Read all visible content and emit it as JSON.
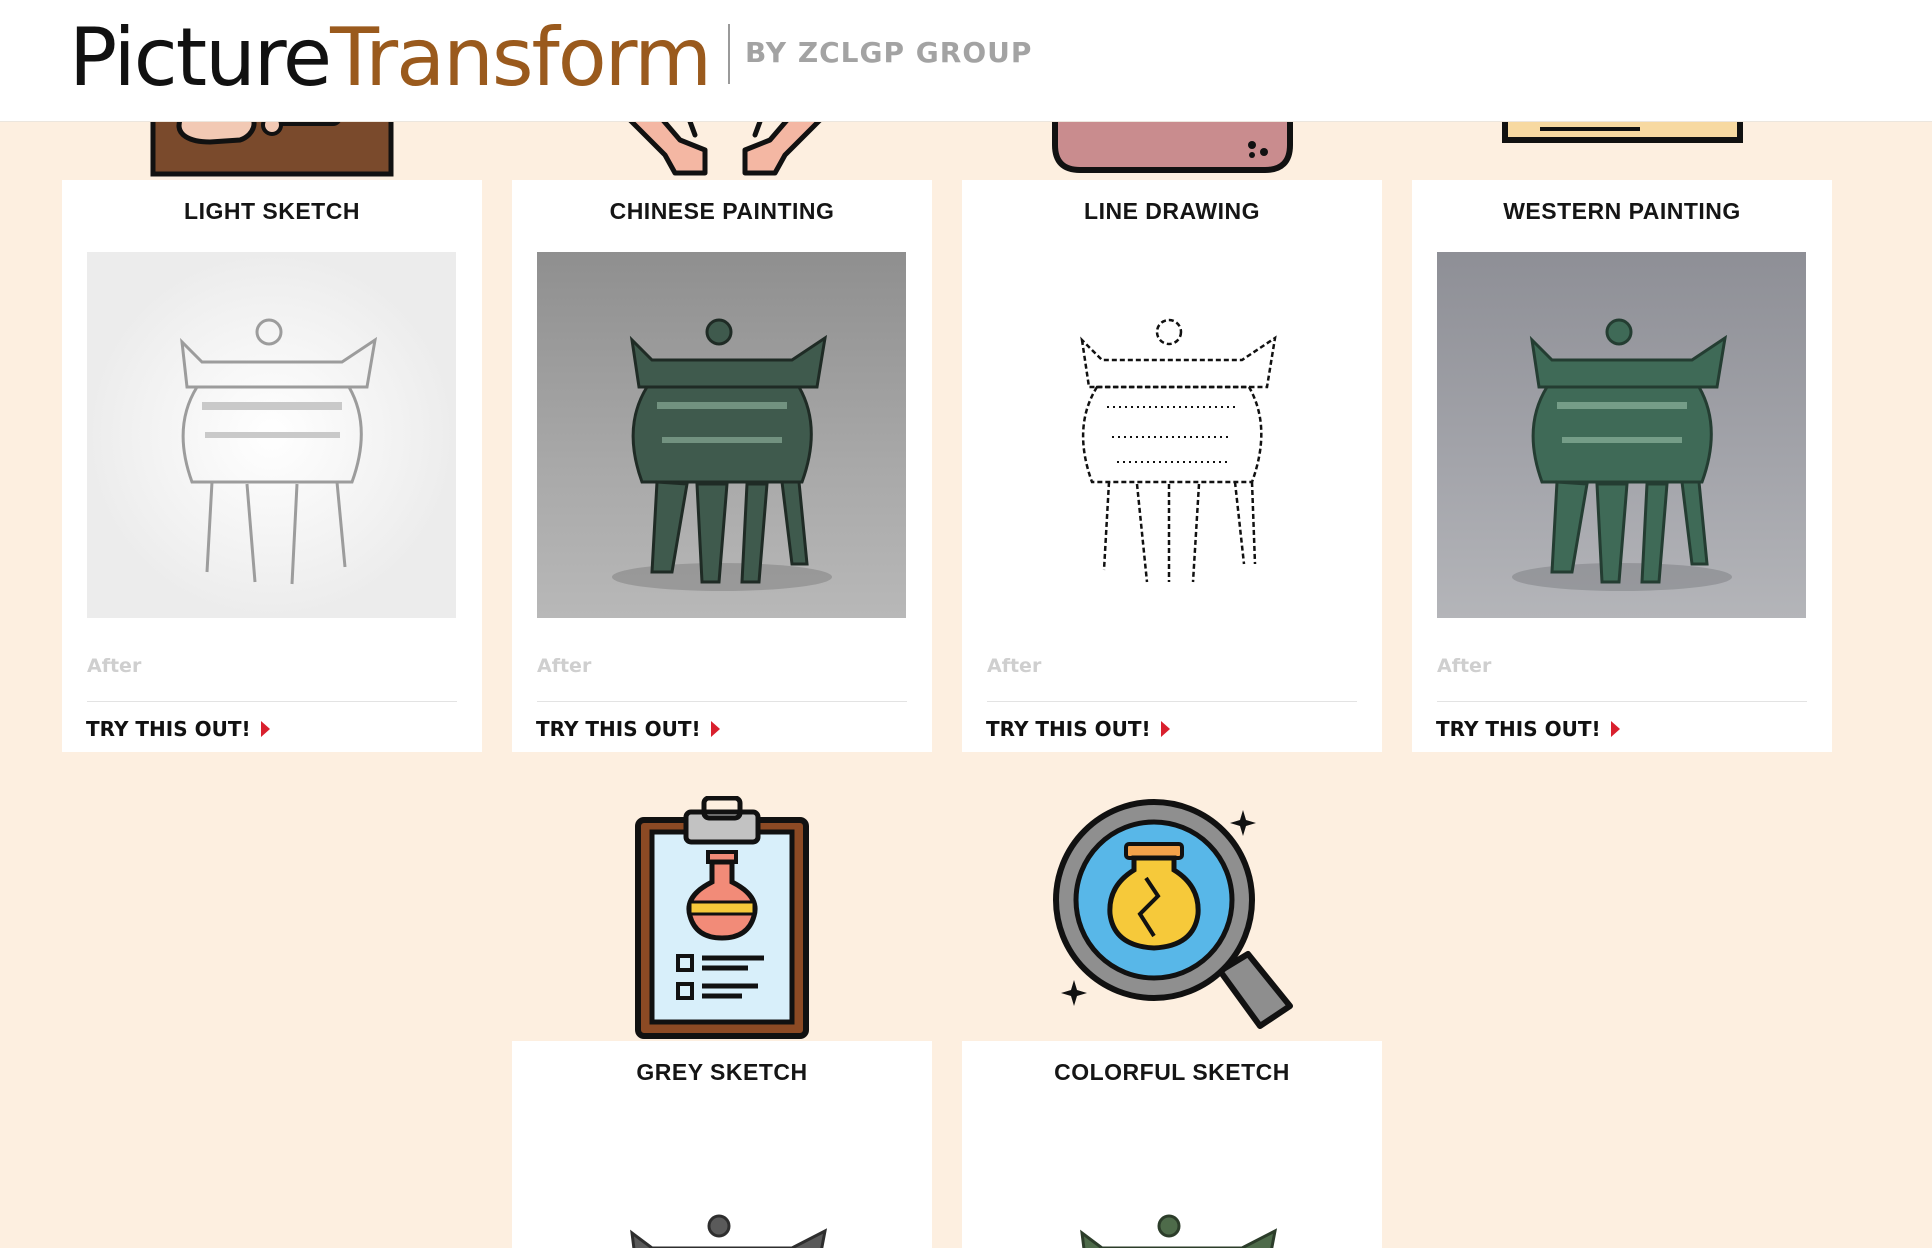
{
  "header": {
    "logo_part1": "Picture",
    "logo_part2": "Transform",
    "byline": "BY ZCLGP GROUP"
  },
  "cards": [
    {
      "title": "LIGHT SKETCH",
      "caption": "After",
      "link": "TRY THIS OUT!"
    },
    {
      "title": "CHINESE PAINTING",
      "caption": "After",
      "link": "TRY THIS OUT!"
    },
    {
      "title": "LINE DRAWING",
      "caption": "After",
      "link": "TRY THIS OUT!"
    },
    {
      "title": "WESTERN PAINTING",
      "caption": "After",
      "link": "TRY THIS OUT!"
    },
    {
      "title": "GREY SKETCH"
    },
    {
      "title": "COLORFUL SKETCH"
    }
  ],
  "icons": [
    "fossil-icon",
    "hands-icon",
    "box-icon",
    "tablet-icon",
    "clipboard-vase-icon",
    "magnifier-vase-icon"
  ],
  "colors": {
    "page_background": "#fdefe0",
    "logo_dark": "#111111",
    "logo_brown": "#9a5a1d",
    "byline_gray": "#a3a3a3",
    "link_arrow_red": "#d9202e"
  }
}
